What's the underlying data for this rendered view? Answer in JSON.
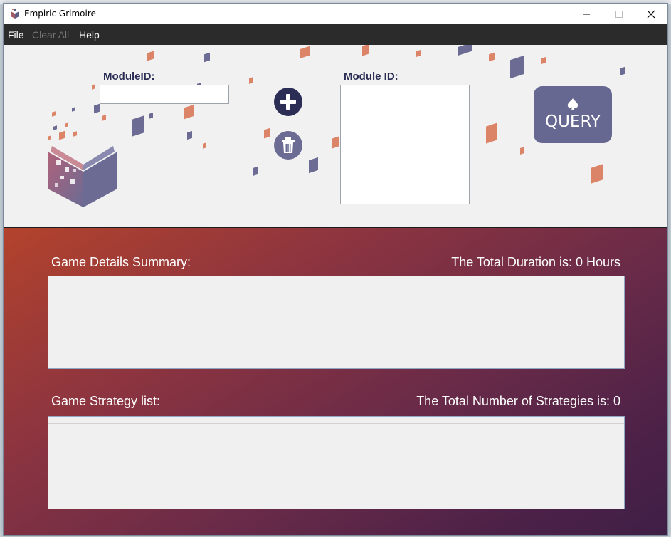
{
  "window": {
    "title": "Empiric Grimoire",
    "controls": {
      "minimize": "minimize-icon",
      "maximize": "maximize-icon",
      "close": "close-icon"
    }
  },
  "menu": {
    "items": [
      {
        "label": "File",
        "enabled": true
      },
      {
        "label": "Clear All",
        "enabled": false
      },
      {
        "label": "Help",
        "enabled": true
      }
    ]
  },
  "header": {
    "module_id_input": {
      "label": "ModuleID:",
      "value": ""
    },
    "add_button": {
      "icon": "plus-icon"
    },
    "delete_button": {
      "icon": "trash-icon"
    },
    "module_list": {
      "label": "Module ID:",
      "items": []
    },
    "query_button": {
      "label": "QUERY",
      "icon": "spade-icon"
    }
  },
  "details": {
    "title": "Game Details Summary:",
    "total_duration": "The Total Duration is: 0 Hours",
    "rows": []
  },
  "strategies": {
    "title": "Game Strategy list:",
    "total_count": "The Total Number of Strategies is: 0",
    "rows": []
  },
  "colors": {
    "menubar": "#2b2b2b",
    "accent_navy": "#2b2d55",
    "query_button": "#676891",
    "diamond_orange": "#dc8468",
    "diamond_purple": "#6b6b94",
    "gradient_start": "#b3432c",
    "gradient_end": "#3f1f46"
  }
}
